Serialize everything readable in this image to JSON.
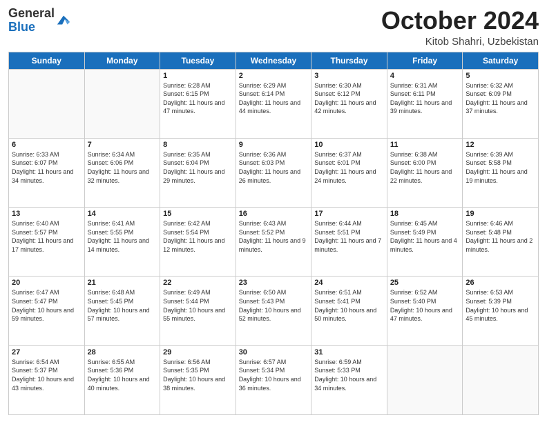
{
  "header": {
    "logo_general": "General",
    "logo_blue": "Blue",
    "title": "October 2024",
    "location": "Kitob Shahri, Uzbekistan"
  },
  "weekdays": [
    "Sunday",
    "Monday",
    "Tuesday",
    "Wednesday",
    "Thursday",
    "Friday",
    "Saturday"
  ],
  "weeks": [
    [
      {
        "day": "",
        "info": ""
      },
      {
        "day": "",
        "info": ""
      },
      {
        "day": "1",
        "info": "Sunrise: 6:28 AM\nSunset: 6:15 PM\nDaylight: 11 hours and 47 minutes."
      },
      {
        "day": "2",
        "info": "Sunrise: 6:29 AM\nSunset: 6:14 PM\nDaylight: 11 hours and 44 minutes."
      },
      {
        "day": "3",
        "info": "Sunrise: 6:30 AM\nSunset: 6:12 PM\nDaylight: 11 hours and 42 minutes."
      },
      {
        "day": "4",
        "info": "Sunrise: 6:31 AM\nSunset: 6:11 PM\nDaylight: 11 hours and 39 minutes."
      },
      {
        "day": "5",
        "info": "Sunrise: 6:32 AM\nSunset: 6:09 PM\nDaylight: 11 hours and 37 minutes."
      }
    ],
    [
      {
        "day": "6",
        "info": "Sunrise: 6:33 AM\nSunset: 6:07 PM\nDaylight: 11 hours and 34 minutes."
      },
      {
        "day": "7",
        "info": "Sunrise: 6:34 AM\nSunset: 6:06 PM\nDaylight: 11 hours and 32 minutes."
      },
      {
        "day": "8",
        "info": "Sunrise: 6:35 AM\nSunset: 6:04 PM\nDaylight: 11 hours and 29 minutes."
      },
      {
        "day": "9",
        "info": "Sunrise: 6:36 AM\nSunset: 6:03 PM\nDaylight: 11 hours and 26 minutes."
      },
      {
        "day": "10",
        "info": "Sunrise: 6:37 AM\nSunset: 6:01 PM\nDaylight: 11 hours and 24 minutes."
      },
      {
        "day": "11",
        "info": "Sunrise: 6:38 AM\nSunset: 6:00 PM\nDaylight: 11 hours and 22 minutes."
      },
      {
        "day": "12",
        "info": "Sunrise: 6:39 AM\nSunset: 5:58 PM\nDaylight: 11 hours and 19 minutes."
      }
    ],
    [
      {
        "day": "13",
        "info": "Sunrise: 6:40 AM\nSunset: 5:57 PM\nDaylight: 11 hours and 17 minutes."
      },
      {
        "day": "14",
        "info": "Sunrise: 6:41 AM\nSunset: 5:55 PM\nDaylight: 11 hours and 14 minutes."
      },
      {
        "day": "15",
        "info": "Sunrise: 6:42 AM\nSunset: 5:54 PM\nDaylight: 11 hours and 12 minutes."
      },
      {
        "day": "16",
        "info": "Sunrise: 6:43 AM\nSunset: 5:52 PM\nDaylight: 11 hours and 9 minutes."
      },
      {
        "day": "17",
        "info": "Sunrise: 6:44 AM\nSunset: 5:51 PM\nDaylight: 11 hours and 7 minutes."
      },
      {
        "day": "18",
        "info": "Sunrise: 6:45 AM\nSunset: 5:49 PM\nDaylight: 11 hours and 4 minutes."
      },
      {
        "day": "19",
        "info": "Sunrise: 6:46 AM\nSunset: 5:48 PM\nDaylight: 11 hours and 2 minutes."
      }
    ],
    [
      {
        "day": "20",
        "info": "Sunrise: 6:47 AM\nSunset: 5:47 PM\nDaylight: 10 hours and 59 minutes."
      },
      {
        "day": "21",
        "info": "Sunrise: 6:48 AM\nSunset: 5:45 PM\nDaylight: 10 hours and 57 minutes."
      },
      {
        "day": "22",
        "info": "Sunrise: 6:49 AM\nSunset: 5:44 PM\nDaylight: 10 hours and 55 minutes."
      },
      {
        "day": "23",
        "info": "Sunrise: 6:50 AM\nSunset: 5:43 PM\nDaylight: 10 hours and 52 minutes."
      },
      {
        "day": "24",
        "info": "Sunrise: 6:51 AM\nSunset: 5:41 PM\nDaylight: 10 hours and 50 minutes."
      },
      {
        "day": "25",
        "info": "Sunrise: 6:52 AM\nSunset: 5:40 PM\nDaylight: 10 hours and 47 minutes."
      },
      {
        "day": "26",
        "info": "Sunrise: 6:53 AM\nSunset: 5:39 PM\nDaylight: 10 hours and 45 minutes."
      }
    ],
    [
      {
        "day": "27",
        "info": "Sunrise: 6:54 AM\nSunset: 5:37 PM\nDaylight: 10 hours and 43 minutes."
      },
      {
        "day": "28",
        "info": "Sunrise: 6:55 AM\nSunset: 5:36 PM\nDaylight: 10 hours and 40 minutes."
      },
      {
        "day": "29",
        "info": "Sunrise: 6:56 AM\nSunset: 5:35 PM\nDaylight: 10 hours and 38 minutes."
      },
      {
        "day": "30",
        "info": "Sunrise: 6:57 AM\nSunset: 5:34 PM\nDaylight: 10 hours and 36 minutes."
      },
      {
        "day": "31",
        "info": "Sunrise: 6:59 AM\nSunset: 5:33 PM\nDaylight: 10 hours and 34 minutes."
      },
      {
        "day": "",
        "info": ""
      },
      {
        "day": "",
        "info": ""
      }
    ]
  ]
}
